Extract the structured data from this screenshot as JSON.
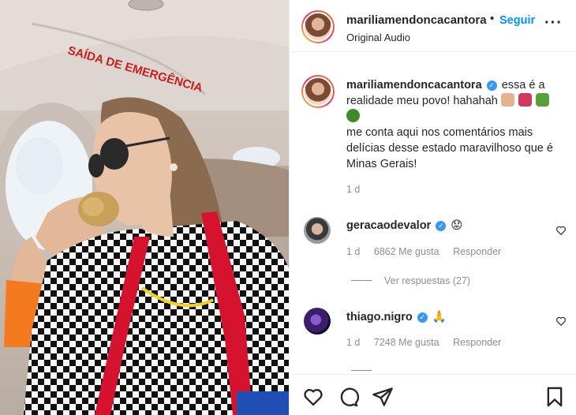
{
  "post": {
    "author": "mariliamendoncacantora",
    "separator": "•",
    "follow_label": "Seguir",
    "audio_label": "Original Audio",
    "more_icon": "more-horizontal-icon"
  },
  "media": {
    "sign_text": "SAÍDA DE EMERGÊNCIA"
  },
  "caption": {
    "username": "mariliamendoncacantora",
    "line1": "essa é a realidade meu povo! hahahah",
    "line2": "me conta aqui nos comentários mais delícias desse estado maravilhoso que é Minas Gerais!",
    "time": "1 d"
  },
  "comments": [
    {
      "username": "geracaodevalor",
      "text": "😟",
      "time": "1 d",
      "likes": "6862 Me gusta",
      "reply_label": "Responder",
      "view_replies": "Ver respuestas (27)"
    },
    {
      "username": "thiago.nigro",
      "text": "🙏",
      "time": "1 d",
      "likes": "7248 Me gusta",
      "reply_label": "Responder"
    }
  ],
  "action_icons": [
    "heart-icon",
    "comment-icon",
    "share-icon",
    "bookmark-icon"
  ],
  "colors": {
    "link": "#0095f6",
    "verified": "#3897f0",
    "muted": "#8e8e8e"
  }
}
